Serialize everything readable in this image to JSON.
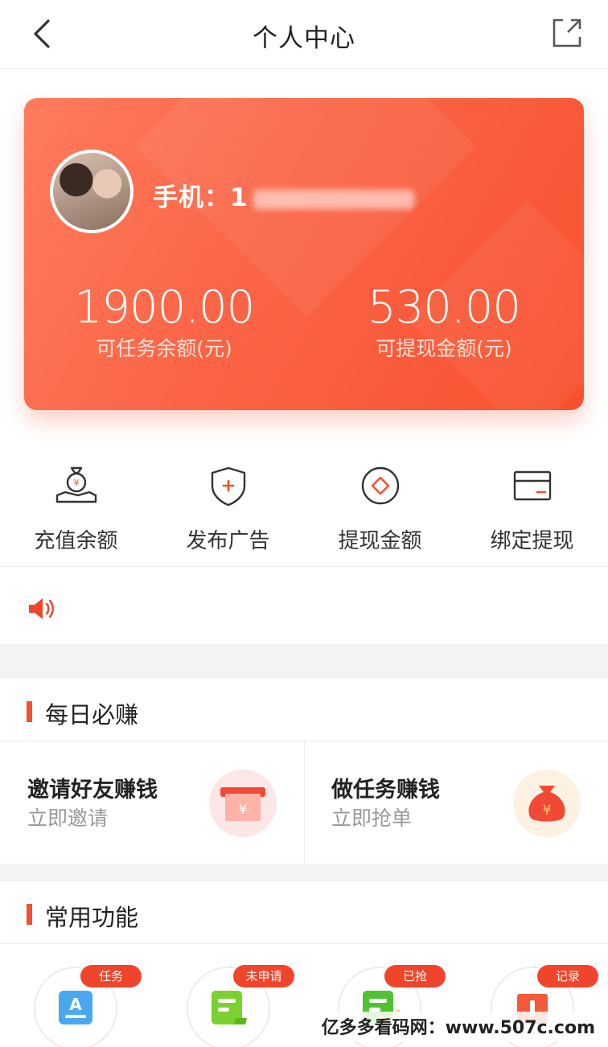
{
  "header": {
    "title": "个人中心"
  },
  "profile": {
    "phone_label": "手机：",
    "phone_visible": "1"
  },
  "balances": [
    {
      "amount": "1900.00",
      "label": "可任务余额(元)"
    },
    {
      "amount": "530.00",
      "label": "可提现金额(元)"
    }
  ],
  "quick_actions": [
    {
      "label": "充值余额",
      "icon": "money-bag-hand-icon"
    },
    {
      "label": "发布广告",
      "icon": "shield-plus-icon"
    },
    {
      "label": "提现金额",
      "icon": "diamond-circle-icon"
    },
    {
      "label": "绑定提现",
      "icon": "card-icon"
    }
  ],
  "notice": {
    "icon": "speaker-icon",
    "text": ""
  },
  "daily": {
    "title": "每日必赚",
    "items": [
      {
        "title": "邀请好友赚钱",
        "subtitle": "立即邀请",
        "icon": "red-envelope-icon",
        "icon_bg": "#fde7e6"
      },
      {
        "title": "做任务赚钱",
        "subtitle": "立即抢单",
        "icon": "money-bag-icon",
        "icon_bg": "#fdf1e2"
      }
    ]
  },
  "common": {
    "title": "常用功能",
    "items": [
      {
        "tag": "任务",
        "icon": "task-icon"
      },
      {
        "tag": "未申请",
        "icon": "document-icon"
      },
      {
        "tag": "已抢",
        "icon": "checked-document-icon"
      },
      {
        "tag": "记录",
        "icon": "record-book-icon"
      }
    ]
  },
  "watermark": "亿多多看码网：www.507c.com",
  "colors": {
    "accent": "#f0512e",
    "card_start": "#ff7b5c",
    "card_end": "#f7512f",
    "tag": "#f0452a"
  }
}
